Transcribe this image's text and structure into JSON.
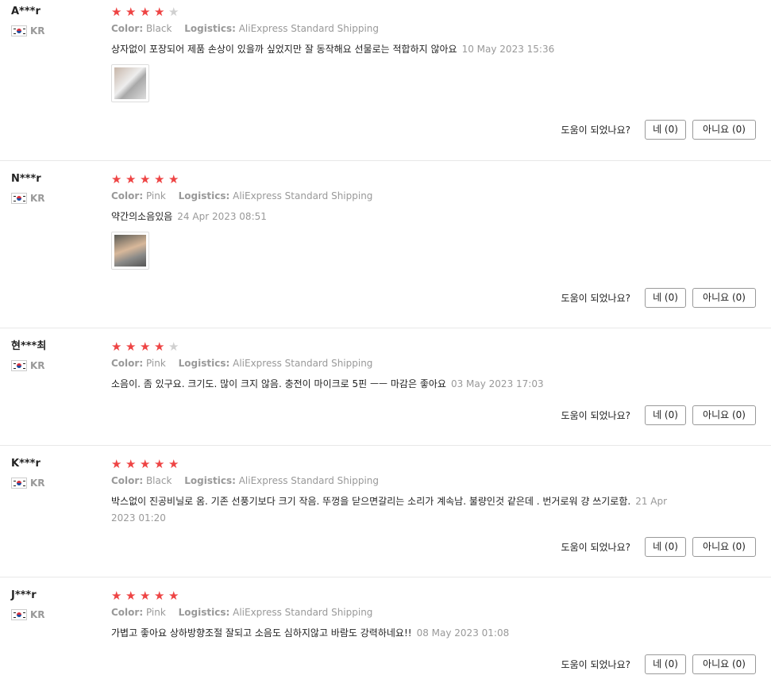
{
  "labels": {
    "color": "Color:",
    "logistics": "Logistics:",
    "helpful_question": "도움이 되었나요?"
  },
  "colors": {
    "star_on": "#ee4444",
    "star_off": "#d0d0d0",
    "muted_text": "#999999"
  },
  "reviews": [
    {
      "buyer": "A***r",
      "country": "KR",
      "rating": 4,
      "rating_max": 5,
      "color": "Black",
      "logistics": "AliExpress Standard Shipping",
      "text": "상자없이 포장되어 제품 손상이 있을까 싶었지만 잘 동작해요 선물로는 적합하지 않아요",
      "date": "10 May 2023 15:36",
      "has_photo": true,
      "yes_label": "네 (0)",
      "no_label": "아니요 (0)"
    },
    {
      "buyer": "N***r",
      "country": "KR",
      "rating": 5,
      "rating_max": 5,
      "color": "Pink",
      "logistics": "AliExpress Standard Shipping",
      "text": "약간의소음있음",
      "date": "24 Apr 2023 08:51",
      "has_photo": true,
      "yes_label": "네 (0)",
      "no_label": "아니요 (0)"
    },
    {
      "buyer": "현***최",
      "country": "KR",
      "rating": 4,
      "rating_max": 5,
      "color": "Pink",
      "logistics": "AliExpress Standard Shipping",
      "text": "소음이. 좀 있구요. 크기도. 많이 크지 않음. 충전이 마이크로 5핀 ㅡㅡ 마감은 좋아요",
      "date": "03 May 2023 17:03",
      "has_photo": false,
      "yes_label": "네 (0)",
      "no_label": "아니요 (0)"
    },
    {
      "buyer": "K***r",
      "country": "KR",
      "rating": 5,
      "rating_max": 5,
      "color": "Black",
      "logistics": "AliExpress Standard Shipping",
      "text": "박스없이 진공비닐로 옴. 기존 선풍기보다 크기 작음. 뚜껑을 닫으면갈리는 소리가 계속남. 불량인것 같은데 . 번거로워 걍 쓰기로함.",
      "date": "21 Apr 2023 01:20",
      "has_photo": false,
      "yes_label": "네 (0)",
      "no_label": "아니요 (0)"
    },
    {
      "buyer": "J***r",
      "country": "KR",
      "rating": 5,
      "rating_max": 5,
      "color": "Pink",
      "logistics": "AliExpress Standard Shipping",
      "text": "가볍고 좋아요 상하방향조절 잘되고 소음도 심하지않고 바람도 강력하네요!!",
      "date": "08 May 2023 01:08",
      "has_photo": false,
      "yes_label": "네 (0)",
      "no_label": "아니요 (0)"
    }
  ]
}
